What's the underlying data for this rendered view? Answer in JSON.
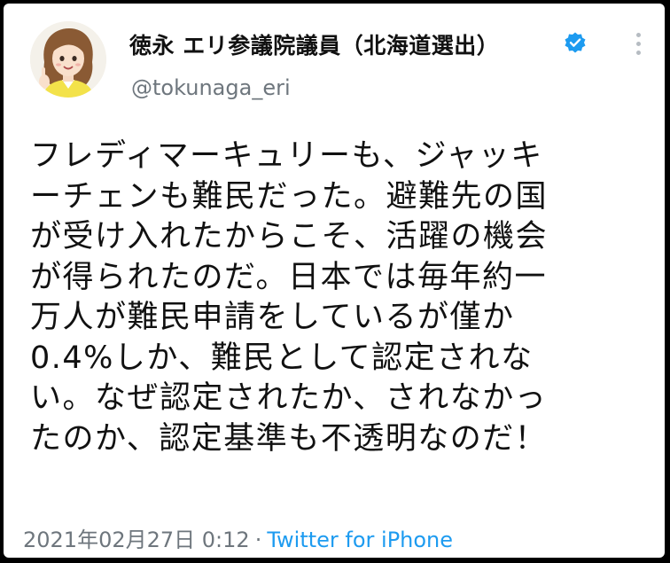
{
  "author": {
    "display_name": "徳永 エリ参議院議員（北海道選出）",
    "handle": "@tokunaga_eri",
    "verified": true,
    "verified_color": "#1d9bf0"
  },
  "tweet": {
    "lines": [
      "フレディマーキュリーも、ジャッキ",
      "ーチェンも難民だった。避難先の国",
      "が受け入れたからこそ、活躍の機会",
      "が得られたのだ。日本では毎年約一",
      "万人が難民申請をしているが僅か",
      "0.4%しか、難民として認定されな",
      "い。なぜ認定されたか、されなかっ",
      "たのか、認定基準も不透明なのだ！"
    ],
    "timestamp": "2021年02月27日 0:12",
    "separator": "·",
    "source": "Twitter for iPhone"
  },
  "icons": {
    "verified": "verified-badge-icon",
    "more": "more-options-icon"
  }
}
